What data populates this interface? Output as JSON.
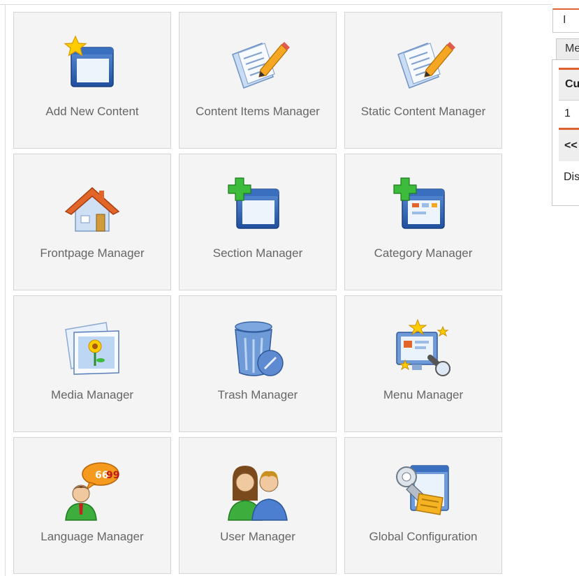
{
  "tiles": [
    {
      "id": "add-new-content",
      "label": "Add New Content",
      "icon": "add-content-icon"
    },
    {
      "id": "content-items-manager",
      "label": "Content Items Manager",
      "icon": "content-items-icon"
    },
    {
      "id": "static-content-manager",
      "label": "Static Content Manager",
      "icon": "static-content-icon"
    },
    {
      "id": "frontpage-manager",
      "label": "Frontpage Manager",
      "icon": "frontpage-home-icon"
    },
    {
      "id": "section-manager",
      "label": "Section Manager",
      "icon": "section-icon"
    },
    {
      "id": "category-manager",
      "label": "Category Manager",
      "icon": "category-icon"
    },
    {
      "id": "media-manager",
      "label": "Media Manager",
      "icon": "media-icon"
    },
    {
      "id": "trash-manager",
      "label": "Trash Manager",
      "icon": "trash-icon"
    },
    {
      "id": "menu-manager",
      "label": "Menu Manager",
      "icon": "menu-icon"
    },
    {
      "id": "language-manager",
      "label": "Language Manager",
      "icon": "language-icon"
    },
    {
      "id": "user-manager",
      "label": "User Manager",
      "icon": "user-icon"
    },
    {
      "id": "global-configuration",
      "label": "Global Configuration",
      "icon": "config-icon"
    }
  ],
  "right_panel": {
    "tab_top": "I",
    "tab_second": "Me",
    "table_header": "Cu",
    "row_value": "1",
    "pagination": "<<",
    "display_label": "Dis"
  },
  "colors": {
    "tile_background": "#f4f4f4",
    "tile_border": "#d5d5d5",
    "label_text": "#666666",
    "accent": "#e06030"
  }
}
